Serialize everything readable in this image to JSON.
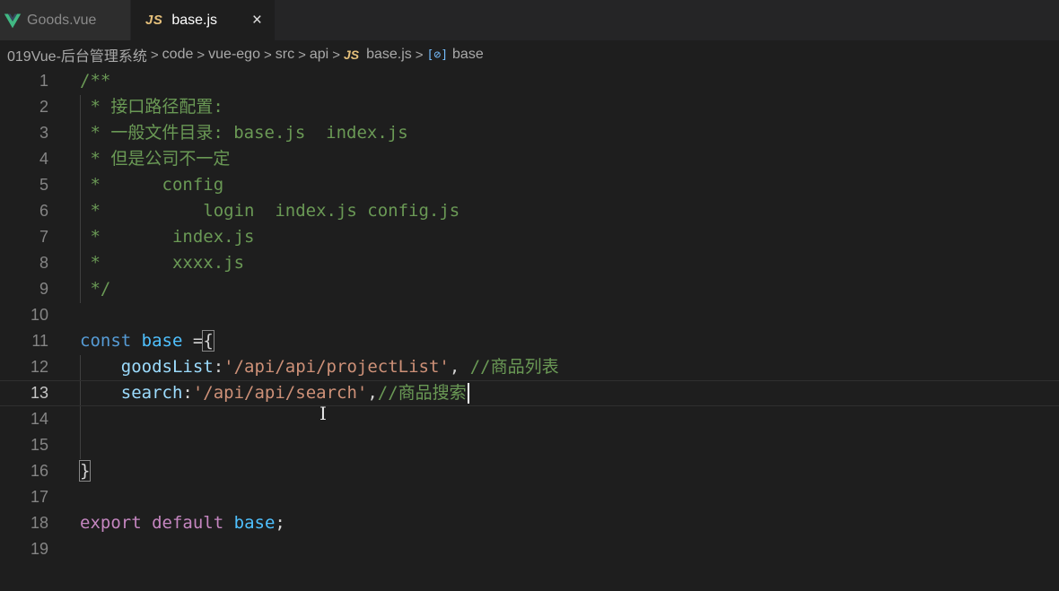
{
  "tabs": [
    {
      "label": "Goods.vue",
      "icon": "vue-icon",
      "active": false
    },
    {
      "label": "base.js",
      "icon": "js-icon",
      "icon_text": "JS",
      "active": true,
      "close": "×"
    }
  ],
  "breadcrumb": {
    "items": [
      "019Vue-后台管理系统",
      "code",
      "vue-ego",
      "src",
      "api"
    ],
    "file_icon_text": "JS",
    "file": "base.js",
    "symbol_icon_text": "[⊘]",
    "symbol": "base",
    "separator": ">"
  },
  "editor": {
    "current_line": 13,
    "lines": [
      {
        "n": "1",
        "tokens": [
          {
            "t": "/**",
            "c": "comment"
          }
        ]
      },
      {
        "n": "2",
        "tokens": [
          {
            "t": " * 接口路径配置:",
            "c": "comment"
          }
        ]
      },
      {
        "n": "3",
        "tokens": [
          {
            "t": " * 一般文件目录: base.js  index.js",
            "c": "comment"
          }
        ]
      },
      {
        "n": "4",
        "tokens": [
          {
            "t": " * 但是公司不一定",
            "c": "comment"
          }
        ]
      },
      {
        "n": "5",
        "tokens": [
          {
            "t": " *      config",
            "c": "comment"
          }
        ]
      },
      {
        "n": "6",
        "tokens": [
          {
            "t": " *          login  index.js config.js",
            "c": "comment"
          }
        ]
      },
      {
        "n": "7",
        "tokens": [
          {
            "t": " *       index.js",
            "c": "comment"
          }
        ]
      },
      {
        "n": "8",
        "tokens": [
          {
            "t": " *       xxxx.js",
            "c": "comment"
          }
        ]
      },
      {
        "n": "9",
        "tokens": [
          {
            "t": " */",
            "c": "comment"
          }
        ]
      },
      {
        "n": "10",
        "tokens": []
      },
      {
        "n": "11",
        "tokens": [
          {
            "t": "const",
            "c": "keyword"
          },
          {
            "t": " ",
            "c": "punct"
          },
          {
            "t": "base",
            "c": "var"
          },
          {
            "t": " =",
            "c": "punct"
          },
          {
            "t": "{",
            "c": "brace-match"
          }
        ]
      },
      {
        "n": "12",
        "tokens": [
          {
            "t": "    ",
            "c": "punct"
          },
          {
            "t": "goodsList",
            "c": "prop"
          },
          {
            "t": ":",
            "c": "punct"
          },
          {
            "t": "'/api/api/projectList'",
            "c": "string"
          },
          {
            "t": ", ",
            "c": "punct"
          },
          {
            "t": "//商品列表",
            "c": "comment"
          }
        ]
      },
      {
        "n": "13",
        "tokens": [
          {
            "t": "    ",
            "c": "punct"
          },
          {
            "t": "search",
            "c": "prop"
          },
          {
            "t": ":",
            "c": "punct"
          },
          {
            "t": "'/api/api/search'",
            "c": "string"
          },
          {
            "t": ",",
            "c": "punct"
          },
          {
            "t": "//商品搜索",
            "c": "comment"
          }
        ],
        "cursor": true
      },
      {
        "n": "14",
        "tokens": []
      },
      {
        "n": "15",
        "tokens": []
      },
      {
        "n": "16",
        "tokens": [
          {
            "t": "}",
            "c": "brace-match"
          }
        ]
      },
      {
        "n": "17",
        "tokens": []
      },
      {
        "n": "18",
        "tokens": [
          {
            "t": "export",
            "c": "export"
          },
          {
            "t": " ",
            "c": "punct"
          },
          {
            "t": "default",
            "c": "export"
          },
          {
            "t": " ",
            "c": "punct"
          },
          {
            "t": "base",
            "c": "var"
          },
          {
            "t": ";",
            "c": "punct"
          }
        ]
      },
      {
        "n": "19",
        "tokens": []
      }
    ]
  },
  "colors": {
    "background": "#1e1e1e",
    "comment": "#6a9955",
    "keyword": "#569cd6",
    "string": "#ce9178",
    "property": "#9cdcfe",
    "js_icon": "#e5c07b",
    "vue_icon": "#41b883"
  }
}
